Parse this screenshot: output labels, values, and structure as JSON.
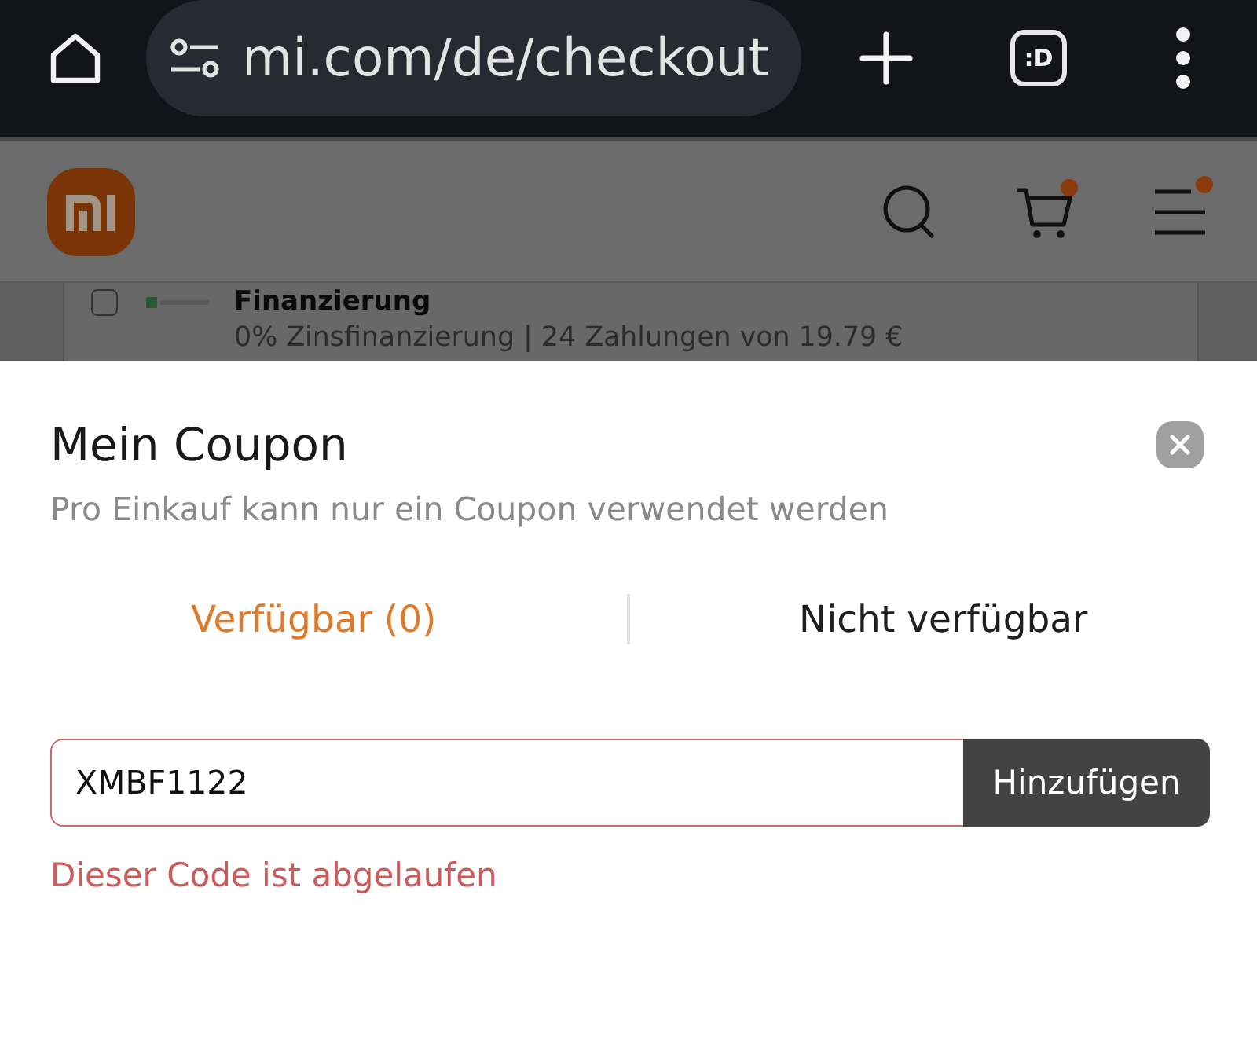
{
  "browser": {
    "url": "mi.com/de/checkout",
    "tab_count": ":D"
  },
  "site_header": {
    "cart_notification": true,
    "menu_notification": true
  },
  "background_page": {
    "payment_option": {
      "title": "Finanzierung",
      "detail": "0% Zinsfinanzierung | 24 Zahlungen von 19.79 €",
      "checked": false
    }
  },
  "coupon_sheet": {
    "title": "Mein Coupon",
    "subtitle": "Pro Einkauf kann nur ein Coupon verwendet werden",
    "tabs": [
      {
        "label": "Verfügbar (0)",
        "selected": true
      },
      {
        "label": "Nicht verfügbar",
        "selected": false
      }
    ],
    "code_field": {
      "value": "XMBF1122",
      "error": true
    },
    "add_button": "Hinzufügen",
    "error_message": "Dieser Code ist abgelaufen"
  }
}
